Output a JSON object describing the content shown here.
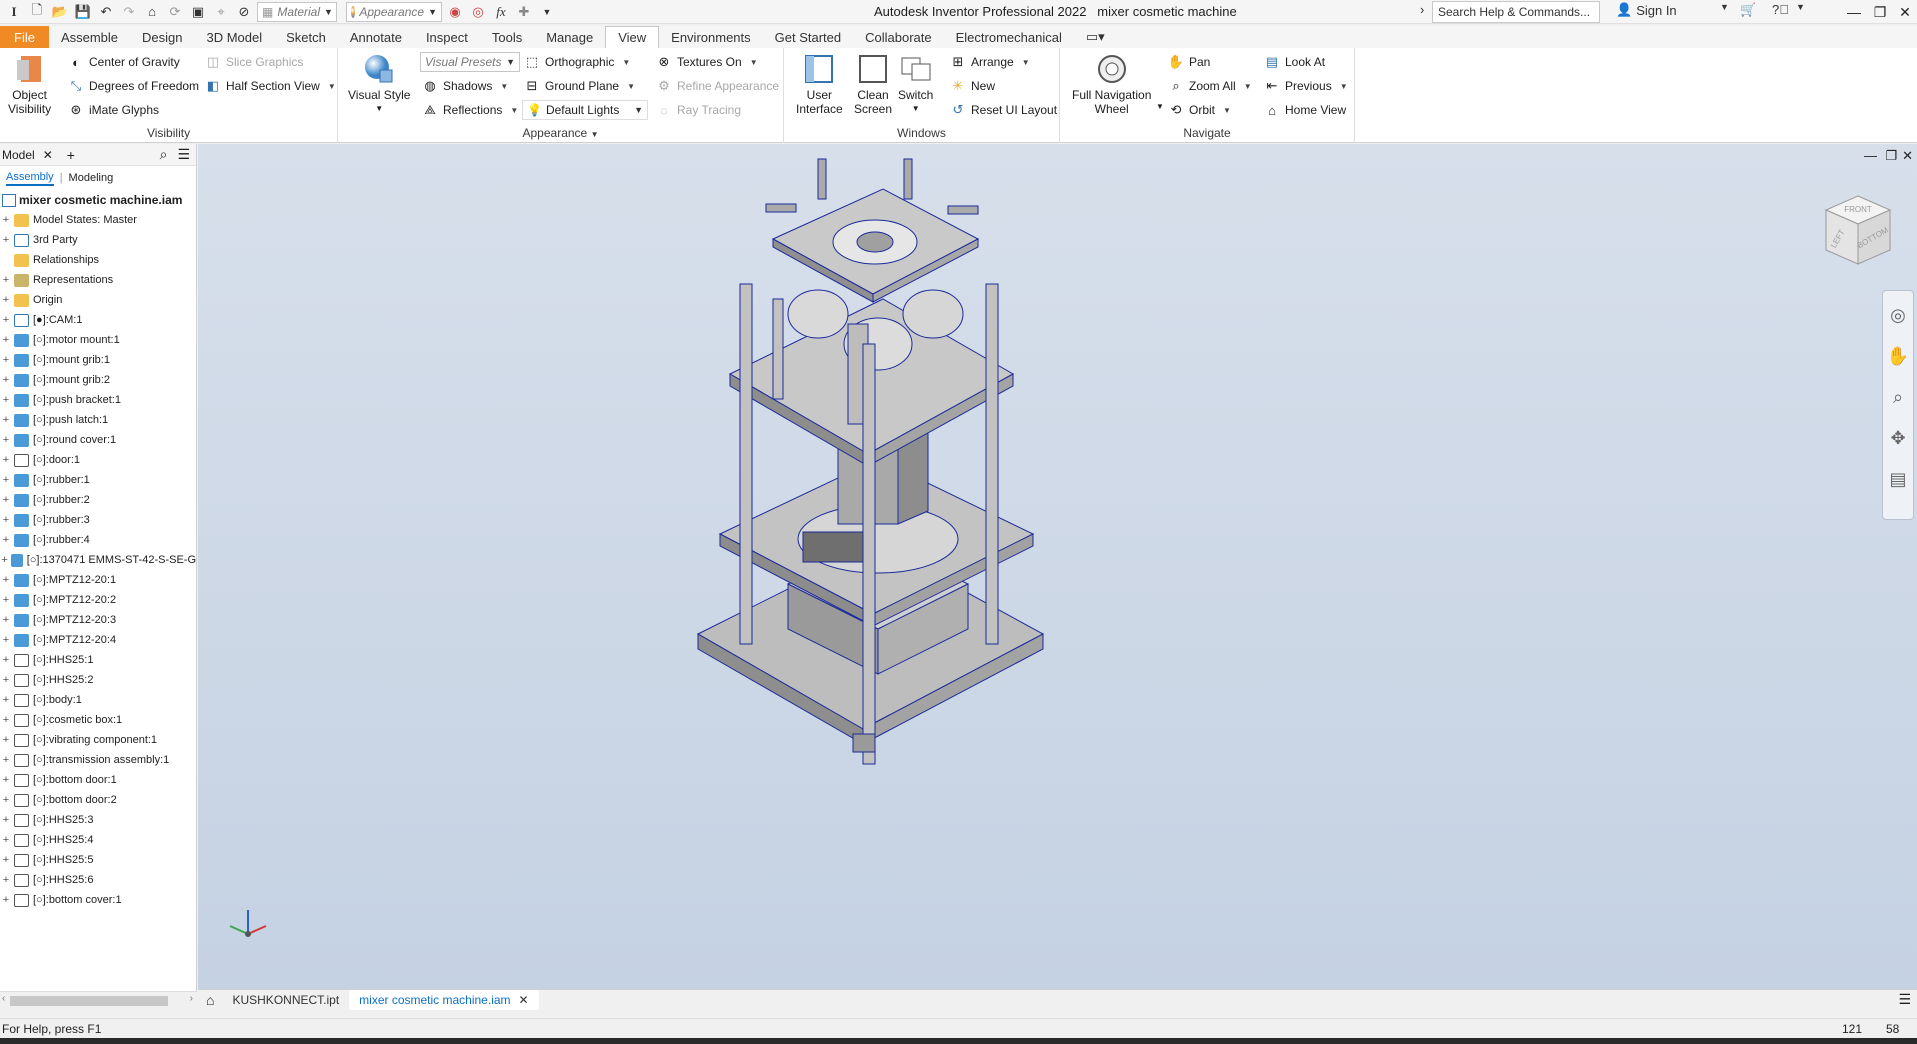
{
  "app": {
    "title": "Autodesk Inventor Professional 2022   mixer cosmetic machine",
    "material_placeholder": "Material",
    "appearance_placeholder": "Appearance",
    "search_placeholder": "Search Help & Commands...",
    "sign_in": "Sign In"
  },
  "tabs": [
    "File",
    "Assemble",
    "Design",
    "3D Model",
    "Sketch",
    "Annotate",
    "Inspect",
    "Tools",
    "Manage",
    "View",
    "Environments",
    "Get Started",
    "Collaborate",
    "Electromechanical"
  ],
  "active_tab": "View",
  "ribbon": {
    "visibility": {
      "title": "Visibility",
      "object_visibility": "Object\nVisibility",
      "center_of_gravity": "Center of Gravity",
      "degrees_of_freedom": "Degrees of Freedom",
      "imate_glyphs": "iMate Glyphs",
      "slice_graphics": "Slice Graphics",
      "half_section_view": "Half Section View"
    },
    "appearance": {
      "title": "Appearance",
      "visual_style": "Visual Style",
      "visual_presets": "Visual Presets",
      "shadows": "Shadows",
      "reflections": "Reflections",
      "orthographic": "Orthographic",
      "ground_plane": "Ground Plane",
      "default_lights": "Default Lights",
      "textures_on": "Textures On",
      "refine_appearance": "Refine Appearance",
      "ray_tracing": "Ray Tracing"
    },
    "windows": {
      "title": "Windows",
      "user_interface": "User\nInterface",
      "clean_screen": "Clean\nScreen",
      "switch": "Switch",
      "arrange": "Arrange",
      "new": "New",
      "reset_ui_layout": "Reset UI Layout"
    },
    "navigate": {
      "title": "Navigate",
      "full_navigation_wheel": "Full Navigation\nWheel",
      "pan": "Pan",
      "zoom_all": "Zoom All",
      "orbit": "Orbit",
      "look_at": "Look At",
      "previous": "Previous",
      "home_view": "Home View"
    }
  },
  "browser": {
    "tab_label": "Model",
    "sub_tabs": [
      "Assembly",
      "Modeling"
    ],
    "root": "mixer cosmetic machine.iam",
    "items": [
      {
        "label": "Model States: Master",
        "icon": "folder"
      },
      {
        "label": "3rd Party",
        "icon": "cam"
      },
      {
        "label": "Relationships",
        "icon": "folder"
      },
      {
        "label": "Representations",
        "icon": "rep"
      },
      {
        "label": "Origin",
        "icon": "origin"
      },
      {
        "label": "[●]:CAM:1",
        "icon": "cam"
      },
      {
        "label": "[○]:motor mount:1",
        "icon": "part"
      },
      {
        "label": "[○]:mount grib:1",
        "icon": "part"
      },
      {
        "label": "[○]:mount grib:2",
        "icon": "part"
      },
      {
        "label": "[○]:push bracket:1",
        "icon": "part"
      },
      {
        "label": "[○]:push latch:1",
        "icon": "part"
      },
      {
        "label": "[○]:round cover:1",
        "icon": "part"
      },
      {
        "label": "[○]:door:1",
        "icon": "asm"
      },
      {
        "label": "[○]:rubber:1",
        "icon": "part"
      },
      {
        "label": "[○]:rubber:2",
        "icon": "part"
      },
      {
        "label": "[○]:rubber:3",
        "icon": "part"
      },
      {
        "label": "[○]:rubber:4",
        "icon": "part"
      },
      {
        "label": "[○]:1370471 EMMS-ST-42-S-SE-G",
        "icon": "part"
      },
      {
        "label": "[○]:MPTZ12-20:1",
        "icon": "part"
      },
      {
        "label": "[○]:MPTZ12-20:2",
        "icon": "part"
      },
      {
        "label": "[○]:MPTZ12-20:3",
        "icon": "part"
      },
      {
        "label": "[○]:MPTZ12-20:4",
        "icon": "part"
      },
      {
        "label": "[○]:HHS25:1",
        "icon": "asm"
      },
      {
        "label": "[○]:HHS25:2",
        "icon": "asm"
      },
      {
        "label": "[○]:body:1",
        "icon": "asm"
      },
      {
        "label": "[○]:cosmetic box:1",
        "icon": "asm"
      },
      {
        "label": "[○]:vibrating component:1",
        "icon": "asm"
      },
      {
        "label": "[○]:transmission assembly:1",
        "icon": "asm"
      },
      {
        "label": "[○]:bottom door:1",
        "icon": "asm"
      },
      {
        "label": "[○]:bottom door:2",
        "icon": "asm"
      },
      {
        "label": "[○]:HHS25:3",
        "icon": "asm"
      },
      {
        "label": "[○]:HHS25:4",
        "icon": "asm"
      },
      {
        "label": "[○]:HHS25:5",
        "icon": "asm"
      },
      {
        "label": "[○]:HHS25:6",
        "icon": "asm"
      },
      {
        "label": "[○]:bottom cover:1",
        "icon": "asm"
      }
    ]
  },
  "doc_tabs": [
    "KUSHKONNECT.ipt",
    "mixer cosmetic machine.iam"
  ],
  "active_doc": "mixer cosmetic machine.iam",
  "status": {
    "help": "For Help, press F1",
    "count_a": "121",
    "count_b": "58"
  },
  "viewcube": {
    "front": "FRONT",
    "left": "LEFT",
    "bottom": "BOTTOM"
  },
  "colors": {
    "file_tab": "#f08a24",
    "accent_blue": "#0b6fc7",
    "viewport_top": "#d7dfeb",
    "viewport_bottom": "#c5d2e3"
  }
}
